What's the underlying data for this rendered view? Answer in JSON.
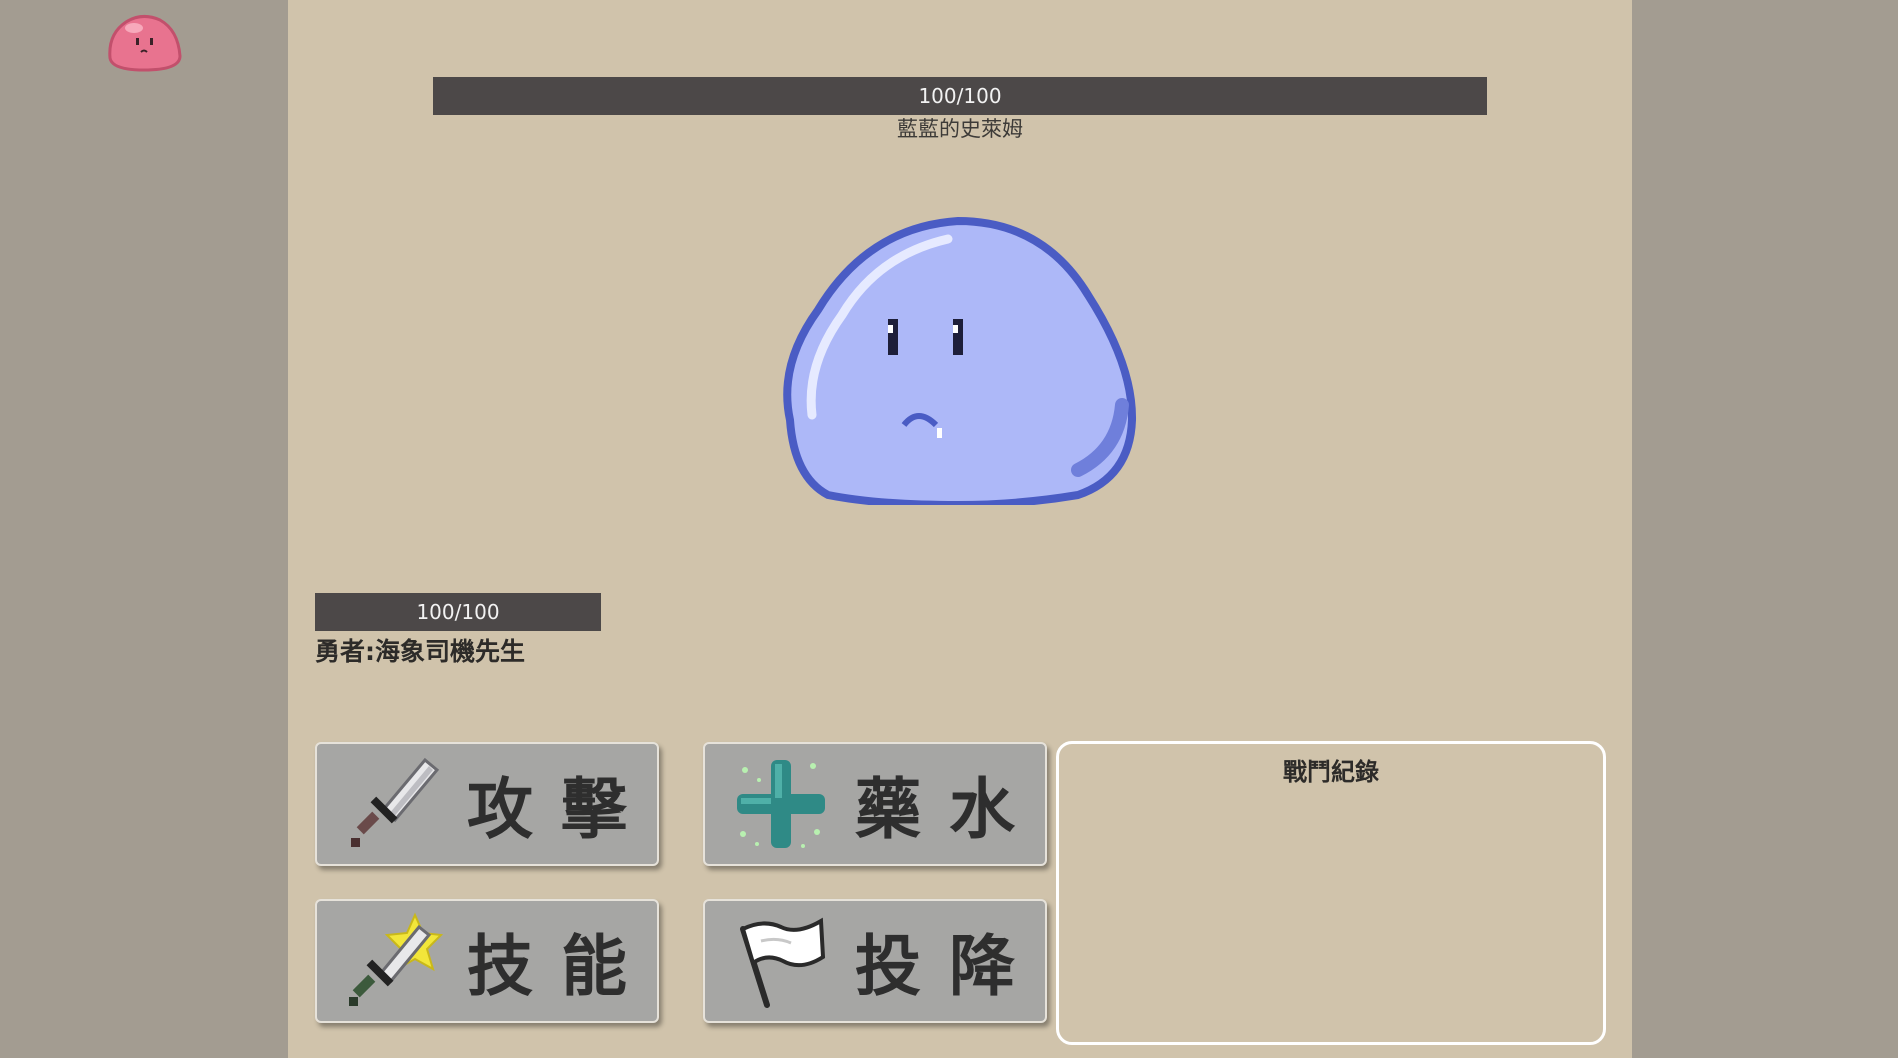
{
  "enemy": {
    "hp_text": "100/100",
    "hp_fraction": 1.0,
    "name": "藍藍的史萊姆",
    "sprite_icon": "blue-slime-sprite"
  },
  "corner_avatar": {
    "icon": "pink-slime-icon",
    "color": "#e8738f"
  },
  "hero": {
    "hp_text": "100/100",
    "hp_fraction": 1.0,
    "name": "勇者:海象司機先生"
  },
  "actions": {
    "attack": {
      "label": "攻擊",
      "icon": "sword-icon"
    },
    "potion": {
      "label": "藥水",
      "icon": "teal-cross-icon"
    },
    "skill": {
      "label": "技能",
      "icon": "magic-sword-icon"
    },
    "flee": {
      "label": "投降",
      "icon": "white-flag-icon"
    }
  },
  "battle_log": {
    "title": "戰鬥紀錄",
    "entries": []
  },
  "colors": {
    "page_bg": "#a39c91",
    "stage_bg": "#d0c3ab",
    "hp_bar": "#4c4848",
    "button_bg": "#a6a6a4",
    "slime_fill": "#adb8f8",
    "slime_outline": "#4a5cc4"
  }
}
